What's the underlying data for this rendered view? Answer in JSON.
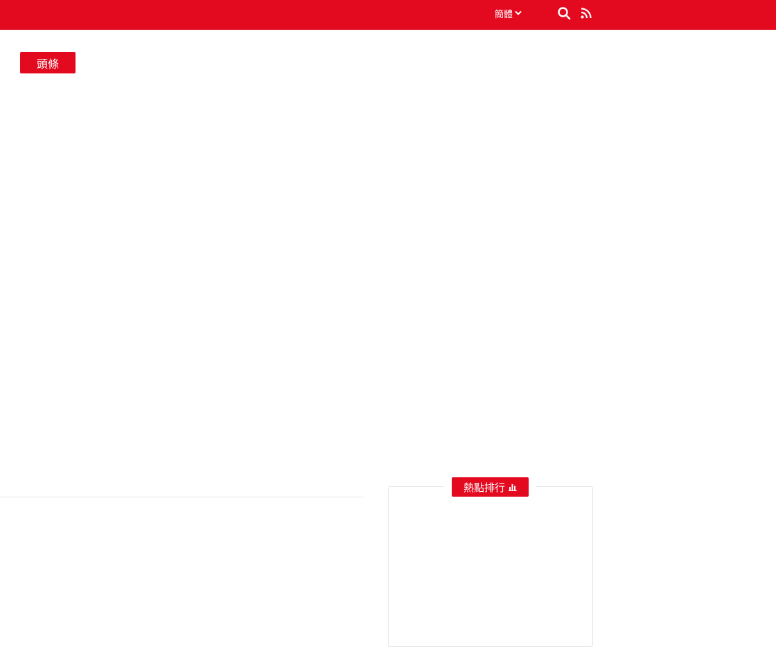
{
  "topbar": {
    "lang_label": "簡體",
    "icons": [
      "chevron-down-icon",
      "search-icon",
      "rss-icon"
    ],
    "color": "#e30a20"
  },
  "main": {
    "headline_label": "頭條"
  },
  "sidebar": {
    "hot_ranking_label": "熱點排行",
    "hot_ranking_icon": "bar-chart-icon"
  }
}
